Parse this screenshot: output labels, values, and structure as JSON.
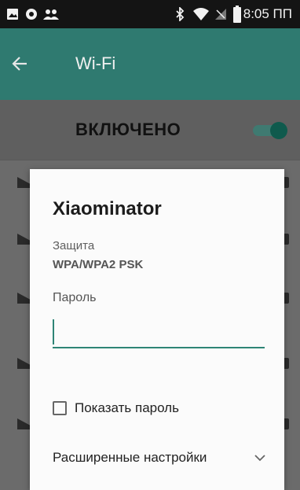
{
  "status_bar": {
    "time": "8:05 ПП",
    "icons": [
      "image-icon",
      "circle-icon",
      "group-icon",
      "bluetooth-icon",
      "wifi-icon",
      "no-signal-icon",
      "battery-icon"
    ]
  },
  "app_bar": {
    "title": "Wi-Fi",
    "back_icon": "arrow-left-icon"
  },
  "master_switch": {
    "label": "ВКЛЮЧЕНО",
    "state": "on"
  },
  "dialog": {
    "title": "Xiaominator",
    "security_label": "Защита",
    "security_value": "WPA/WPA2 PSK",
    "password_label": "Пароль",
    "password_value": "",
    "show_password_label": "Показать пароль",
    "show_password_checked": false,
    "advanced_label": "Расширенные настройки",
    "advanced_icon": "chevron-down-icon"
  },
  "colors": {
    "accent": "#2f8576",
    "app_bar": "#2f7a70",
    "status_bar": "#141414",
    "dialog_bg": "#fbfbfb"
  }
}
